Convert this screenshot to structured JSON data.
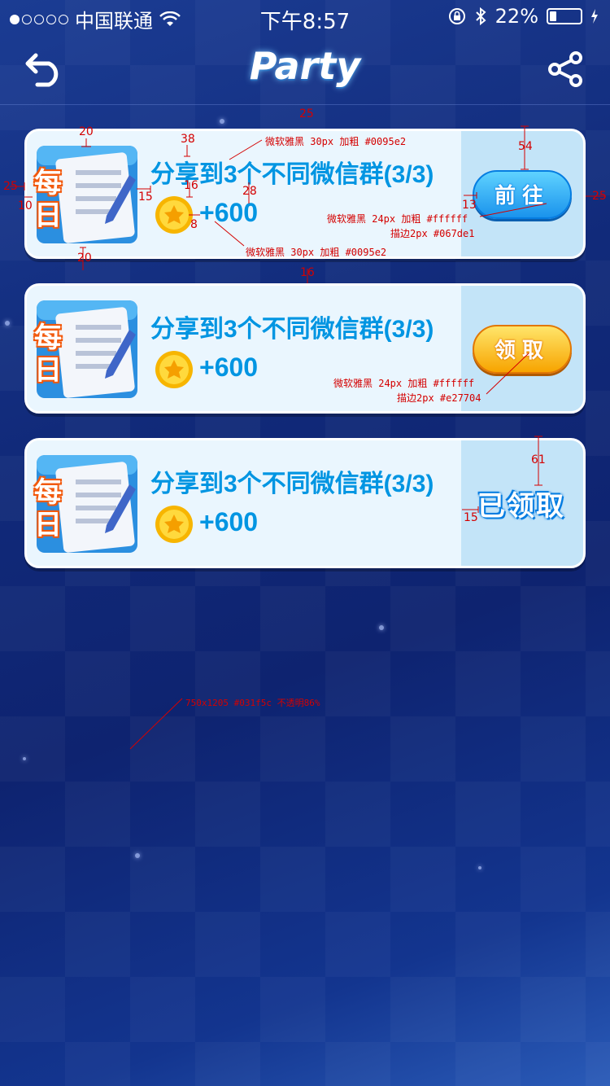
{
  "status_bar": {
    "carrier": "中国联通",
    "time": "下午8:57",
    "battery": "22%",
    "battery_level": 0.22
  },
  "nav": {
    "title": "Party",
    "back_icon": "back-arrow-icon",
    "share_icon": "share-icon"
  },
  "tasks": [
    {
      "badge": "每日",
      "title": "分享到3个不同微信群(3/3)",
      "reward": "+600",
      "action": "前往",
      "state": "go"
    },
    {
      "badge": "每日",
      "title": "分享到3个不同微信群(3/3)",
      "reward": "+600",
      "action": "领取",
      "state": "claim"
    },
    {
      "badge": "每日",
      "title": "分享到3个不同微信群(3/3)",
      "reward": "+600",
      "action": "已领取",
      "state": "claimed"
    }
  ],
  "annotations": {
    "title_spec": "微软雅黑 30px 加粗 #0095e2",
    "reward_spec": "微软雅黑 30px 加粗 #0095e2",
    "go_btn_spec_1": "微软雅黑 24px 加粗 #ffffff",
    "go_btn_spec_2": "描边2px #067de1",
    "claim_btn_spec_1": "微软雅黑 24px 加粗 #ffffff",
    "claim_btn_spec_2": "描边2px #e27704",
    "bg_spec": "750x1205  #031f5c  不透明86%",
    "n25_top": "25",
    "n20_top": "20",
    "n38": "38",
    "n54": "54",
    "n25_left": "25",
    "n10": "10",
    "n15_a": "15",
    "n16_a": "16",
    "n28": "28",
    "n13": "13",
    "n25_right": "25",
    "n8": "8",
    "n20_bottom": "20",
    "n16_b": "16",
    "n61": "61",
    "n15_b": "15"
  },
  "colors": {
    "text_blue": "#0095e2",
    "go_stroke": "#067de1",
    "claim_stroke": "#e27704",
    "bg": "#031f5c"
  }
}
